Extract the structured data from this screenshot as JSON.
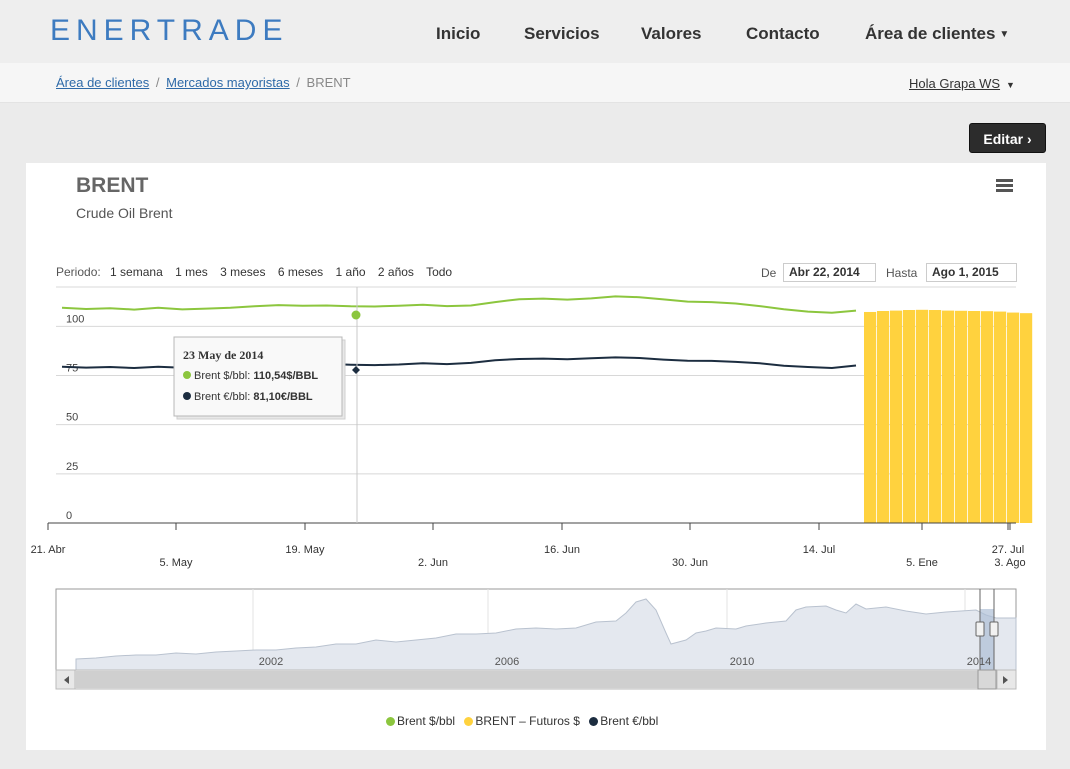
{
  "brand": "ENERTRADE",
  "nav": [
    "Inicio",
    "Servicios",
    "Valores",
    "Contacto",
    "Área de clientes"
  ],
  "breadcrumb": {
    "link1": "Área de clientes",
    "link2": "Mercados mayoristas",
    "current": "BRENT",
    "sep": "/"
  },
  "user": "Hola Grapa WS",
  "edit_label": "Editar ›",
  "chart": {
    "title": "BRENT",
    "subtitle": "Crude Oil Brent"
  },
  "range": {
    "label": "Periodo:",
    "options": [
      "1 semana",
      "1 mes",
      "3 meses",
      "6 meses",
      "1 año",
      "2 años",
      "Todo"
    ]
  },
  "dates": {
    "from_label": "De",
    "from": "Abr 22, 2014",
    "to_label": "Hasta",
    "to": "Ago 1, 2015"
  },
  "tooltip": {
    "date": "23 May de 2014",
    "line1": "Brent $/bbl: ",
    "value1": "110,54$/BBL",
    "line2": "Brent €/bbl: ",
    "value2": "81,10€/BBL"
  },
  "navigator_years": [
    "2002",
    "2006",
    "2010",
    "2014"
  ],
  "legend": [
    "Brent $/bbl",
    "BRENT – Futuros $",
    "Brent €/bbl"
  ],
  "colors": {
    "usd": "#8cc63e",
    "futures": "#ffd23e",
    "eur": "#1c2d40",
    "brand": "#3d7bc0"
  },
  "chart_data": {
    "type": "line",
    "yticks": [
      "0",
      "25",
      "50",
      "75",
      "100"
    ],
    "ylim": [
      0,
      120
    ],
    "x_labels_top": [
      "21. Abr",
      "19. May",
      "16. Jun",
      "14. Jul",
      "27. Jul"
    ],
    "x_labels_bottom": [
      "5. May",
      "2. Jun",
      "30. Jun",
      "5. Ene",
      "3. Ago"
    ],
    "series": [
      {
        "name": "Brent $/bbl",
        "type": "line",
        "values": [
          109.5,
          108.8,
          109.2,
          108.5,
          109.4,
          108.6,
          109.0,
          109.4,
          110.2,
          110.8,
          110.5,
          110.6,
          110.2,
          110.1,
          110.5,
          111.0,
          110.3,
          110.6,
          112.3,
          113.8,
          114.1,
          113.6,
          114.2,
          115.2,
          114.8,
          113.7,
          112.6,
          112.3,
          111.6,
          110.3,
          108.7,
          107.5,
          106.9,
          108.0
        ]
      },
      {
        "name": "Brent €/bbl",
        "type": "line",
        "values": [
          79.5,
          79.0,
          79.3,
          78.8,
          79.4,
          78.9,
          79.6,
          80.3,
          80.8,
          81.1,
          81.0,
          80.9,
          80.5,
          80.3,
          80.6,
          81.2,
          80.8,
          81.4,
          82.8,
          83.4,
          83.6,
          83.3,
          83.8,
          84.2,
          83.9,
          83.1,
          82.5,
          82.4,
          81.9,
          81.2,
          80.0,
          79.3,
          78.8,
          80.1
        ]
      },
      {
        "name": "BRENT – Futuros $",
        "type": "bar",
        "values": [
          107.3,
          107.8,
          108.0,
          108.3,
          108.4,
          108.3,
          108.0,
          107.9,
          107.8,
          107.7,
          107.5,
          107.0,
          106.7
        ]
      }
    ]
  }
}
